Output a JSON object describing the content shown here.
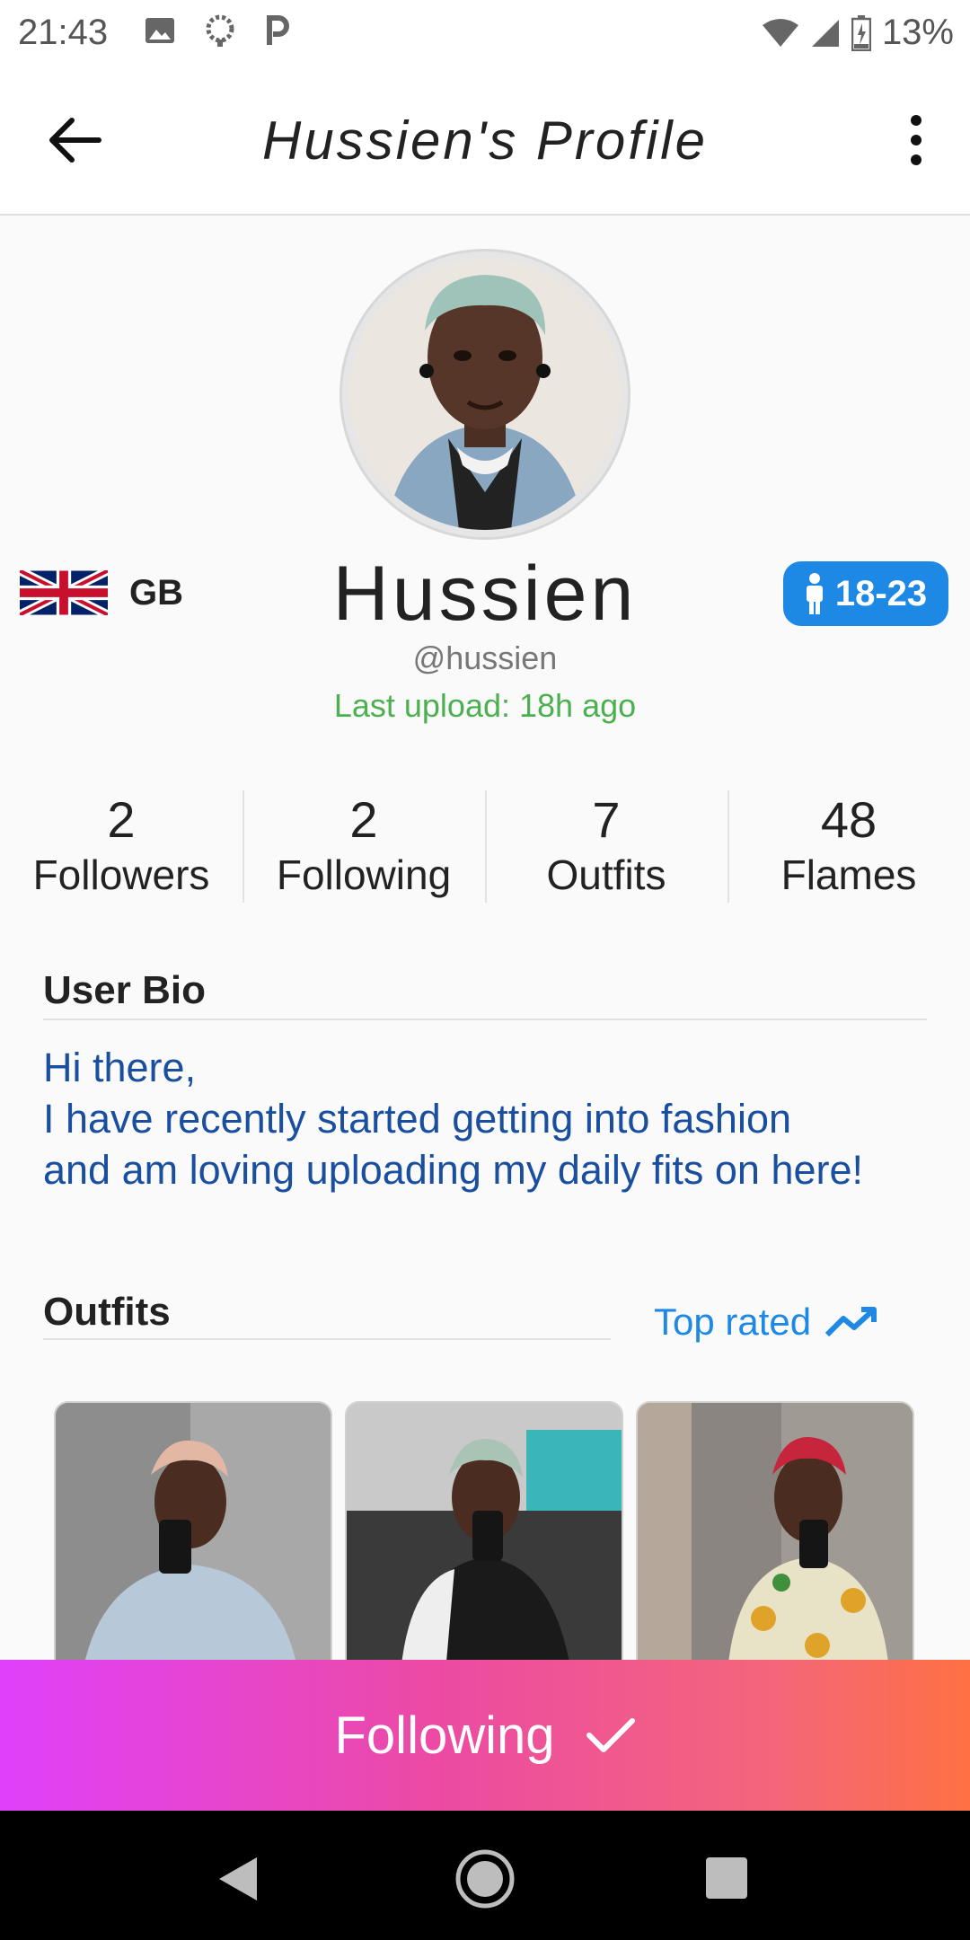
{
  "status": {
    "time": "21:43",
    "battery": "13%"
  },
  "header": {
    "title": "Hussien's Profile"
  },
  "profile": {
    "country_code": "GB",
    "age_range": "18-23",
    "name": "Hussien",
    "username": "@hussien",
    "last_upload": "Last upload: 18h ago"
  },
  "stats": [
    {
      "value": "2",
      "label": "Followers"
    },
    {
      "value": "2",
      "label": "Following"
    },
    {
      "value": "7",
      "label": "Outfits"
    },
    {
      "value": "48",
      "label": "Flames"
    }
  ],
  "bio": {
    "header": "User Bio",
    "text": "Hi there,\nI have recently started getting into fashion\nand am loving uploading my daily fits on here!"
  },
  "outfits": {
    "header": "Outfits",
    "sort_label": "Top rated"
  },
  "follow_button": {
    "label": "Following"
  },
  "colors": {
    "accent": "#1e88e5",
    "green": "#4caf50",
    "bio_text": "#1a4fa0",
    "gradient_start": "#e040fb",
    "gradient_end": "#ff7043"
  }
}
